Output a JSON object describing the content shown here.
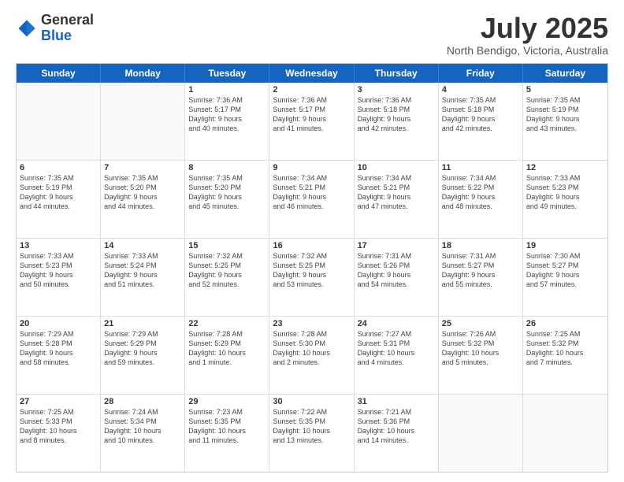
{
  "header": {
    "logo_general": "General",
    "logo_blue": "Blue",
    "title": "July 2025",
    "location": "North Bendigo, Victoria, Australia"
  },
  "weekdays": [
    "Sunday",
    "Monday",
    "Tuesday",
    "Wednesday",
    "Thursday",
    "Friday",
    "Saturday"
  ],
  "rows": [
    [
      {
        "day": "",
        "text": ""
      },
      {
        "day": "",
        "text": ""
      },
      {
        "day": "1",
        "text": "Sunrise: 7:36 AM\nSunset: 5:17 PM\nDaylight: 9 hours\nand 40 minutes."
      },
      {
        "day": "2",
        "text": "Sunrise: 7:36 AM\nSunset: 5:17 PM\nDaylight: 9 hours\nand 41 minutes."
      },
      {
        "day": "3",
        "text": "Sunrise: 7:36 AM\nSunset: 5:18 PM\nDaylight: 9 hours\nand 42 minutes."
      },
      {
        "day": "4",
        "text": "Sunrise: 7:35 AM\nSunset: 5:18 PM\nDaylight: 9 hours\nand 42 minutes."
      },
      {
        "day": "5",
        "text": "Sunrise: 7:35 AM\nSunset: 5:19 PM\nDaylight: 9 hours\nand 43 minutes."
      }
    ],
    [
      {
        "day": "6",
        "text": "Sunrise: 7:35 AM\nSunset: 5:19 PM\nDaylight: 9 hours\nand 44 minutes."
      },
      {
        "day": "7",
        "text": "Sunrise: 7:35 AM\nSunset: 5:20 PM\nDaylight: 9 hours\nand 44 minutes."
      },
      {
        "day": "8",
        "text": "Sunrise: 7:35 AM\nSunset: 5:20 PM\nDaylight: 9 hours\nand 45 minutes."
      },
      {
        "day": "9",
        "text": "Sunrise: 7:34 AM\nSunset: 5:21 PM\nDaylight: 9 hours\nand 46 minutes."
      },
      {
        "day": "10",
        "text": "Sunrise: 7:34 AM\nSunset: 5:21 PM\nDaylight: 9 hours\nand 47 minutes."
      },
      {
        "day": "11",
        "text": "Sunrise: 7:34 AM\nSunset: 5:22 PM\nDaylight: 9 hours\nand 48 minutes."
      },
      {
        "day": "12",
        "text": "Sunrise: 7:33 AM\nSunset: 5:23 PM\nDaylight: 9 hours\nand 49 minutes."
      }
    ],
    [
      {
        "day": "13",
        "text": "Sunrise: 7:33 AM\nSunset: 5:23 PM\nDaylight: 9 hours\nand 50 minutes."
      },
      {
        "day": "14",
        "text": "Sunrise: 7:33 AM\nSunset: 5:24 PM\nDaylight: 9 hours\nand 51 minutes."
      },
      {
        "day": "15",
        "text": "Sunrise: 7:32 AM\nSunset: 5:25 PM\nDaylight: 9 hours\nand 52 minutes."
      },
      {
        "day": "16",
        "text": "Sunrise: 7:32 AM\nSunset: 5:25 PM\nDaylight: 9 hours\nand 53 minutes."
      },
      {
        "day": "17",
        "text": "Sunrise: 7:31 AM\nSunset: 5:26 PM\nDaylight: 9 hours\nand 54 minutes."
      },
      {
        "day": "18",
        "text": "Sunrise: 7:31 AM\nSunset: 5:27 PM\nDaylight: 9 hours\nand 55 minutes."
      },
      {
        "day": "19",
        "text": "Sunrise: 7:30 AM\nSunset: 5:27 PM\nDaylight: 9 hours\nand 57 minutes."
      }
    ],
    [
      {
        "day": "20",
        "text": "Sunrise: 7:29 AM\nSunset: 5:28 PM\nDaylight: 9 hours\nand 58 minutes."
      },
      {
        "day": "21",
        "text": "Sunrise: 7:29 AM\nSunset: 5:29 PM\nDaylight: 9 hours\nand 59 minutes."
      },
      {
        "day": "22",
        "text": "Sunrise: 7:28 AM\nSunset: 5:29 PM\nDaylight: 10 hours\nand 1 minute."
      },
      {
        "day": "23",
        "text": "Sunrise: 7:28 AM\nSunset: 5:30 PM\nDaylight: 10 hours\nand 2 minutes."
      },
      {
        "day": "24",
        "text": "Sunrise: 7:27 AM\nSunset: 5:31 PM\nDaylight: 10 hours\nand 4 minutes."
      },
      {
        "day": "25",
        "text": "Sunrise: 7:26 AM\nSunset: 5:32 PM\nDaylight: 10 hours\nand 5 minutes."
      },
      {
        "day": "26",
        "text": "Sunrise: 7:25 AM\nSunset: 5:32 PM\nDaylight: 10 hours\nand 7 minutes."
      }
    ],
    [
      {
        "day": "27",
        "text": "Sunrise: 7:25 AM\nSunset: 5:33 PM\nDaylight: 10 hours\nand 8 minutes."
      },
      {
        "day": "28",
        "text": "Sunrise: 7:24 AM\nSunset: 5:34 PM\nDaylight: 10 hours\nand 10 minutes."
      },
      {
        "day": "29",
        "text": "Sunrise: 7:23 AM\nSunset: 5:35 PM\nDaylight: 10 hours\nand 11 minutes."
      },
      {
        "day": "30",
        "text": "Sunrise: 7:22 AM\nSunset: 5:35 PM\nDaylight: 10 hours\nand 13 minutes."
      },
      {
        "day": "31",
        "text": "Sunrise: 7:21 AM\nSunset: 5:36 PM\nDaylight: 10 hours\nand 14 minutes."
      },
      {
        "day": "",
        "text": ""
      },
      {
        "day": "",
        "text": ""
      }
    ]
  ]
}
